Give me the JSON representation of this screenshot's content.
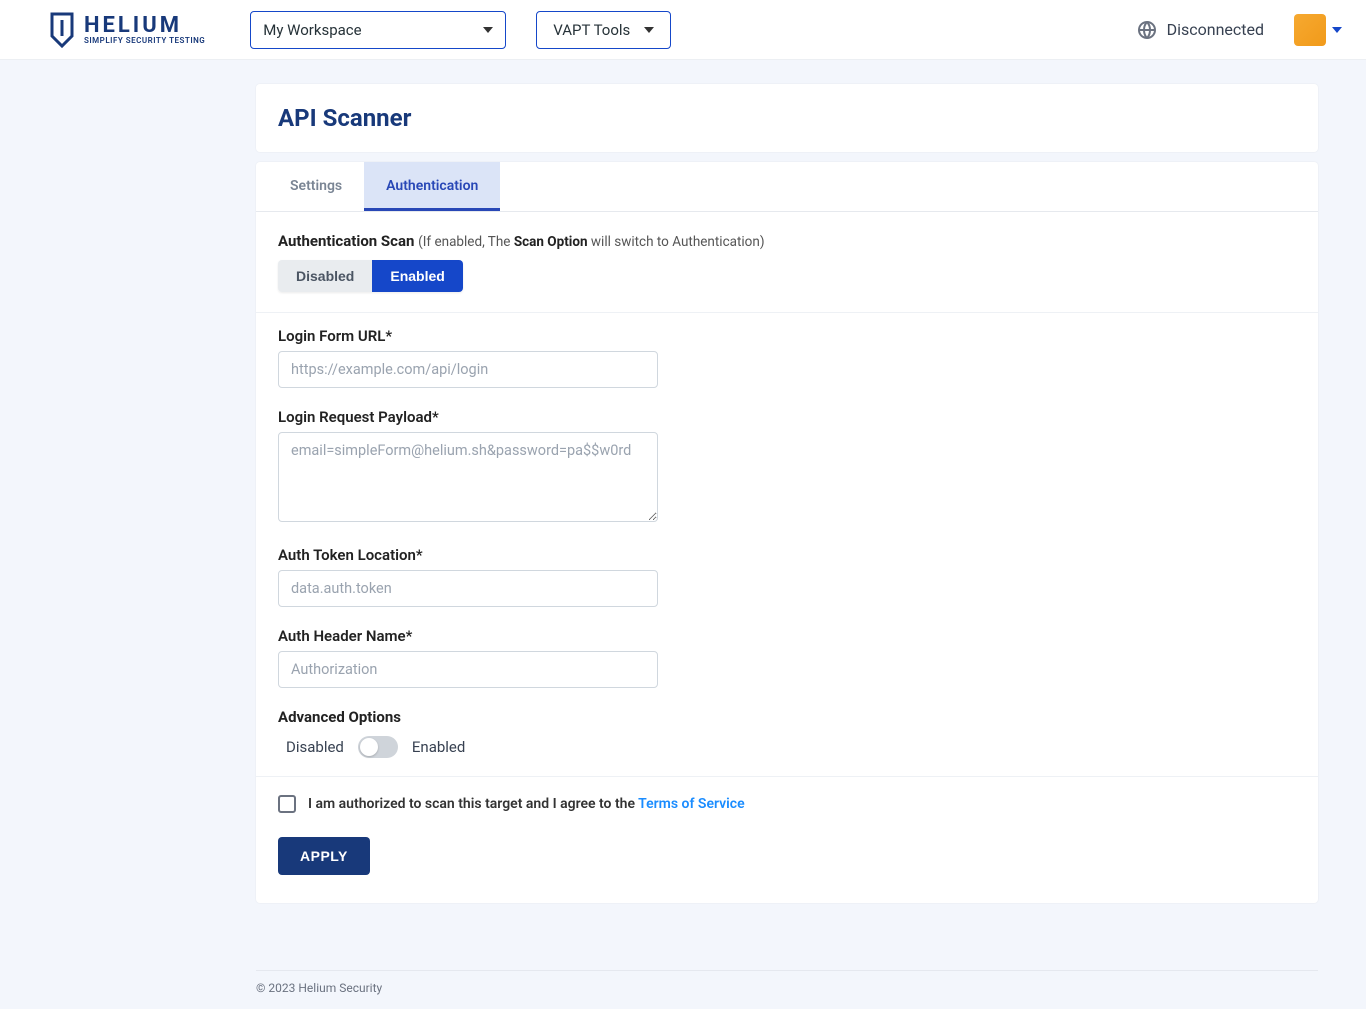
{
  "header": {
    "brand_name": "HELIUM",
    "brand_tagline": "SIMPLIFY SECURITY TESTING",
    "workspace_selected": "My Workspace",
    "tools_selected": "VAPT Tools",
    "connection_status": "Disconnected"
  },
  "page": {
    "title": "API Scanner"
  },
  "tabs": {
    "settings": "Settings",
    "authentication": "Authentication",
    "active": "authentication"
  },
  "auth_scan": {
    "title": "Authentication Scan",
    "hint_pre": "(If enabled, The ",
    "hint_bold": "Scan Option",
    "hint_post": " will switch to Authentication)",
    "disabled_label": "Disabled",
    "enabled_label": "Enabled",
    "value": "enabled"
  },
  "fields": {
    "login_url": {
      "label": "Login Form URL*",
      "placeholder": "https://example.com/api/login",
      "value": ""
    },
    "payload": {
      "label": "Login Request Payload*",
      "placeholder": "email=simpleForm@helium.sh&password=pa$$w0rd",
      "value": ""
    },
    "token_location": {
      "label": "Auth Token Location*",
      "placeholder": "data.auth.token",
      "value": ""
    },
    "header_name": {
      "label": "Auth Header Name*",
      "placeholder": "Authorization",
      "value": ""
    }
  },
  "advanced": {
    "title": "Advanced Options",
    "disabled_label": "Disabled",
    "enabled_label": "Enabled",
    "value": "disabled"
  },
  "consent": {
    "text": "I am authorized to scan this target and I agree to the ",
    "tos_label": "Terms of Service",
    "checked": false
  },
  "actions": {
    "apply": "APPLY"
  },
  "footer": {
    "copyright": "© 2023 Helium Security"
  }
}
